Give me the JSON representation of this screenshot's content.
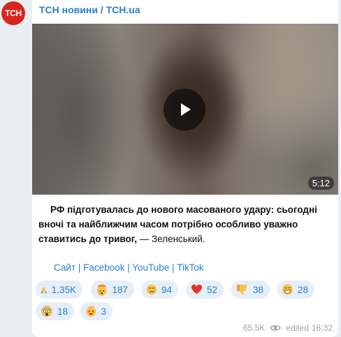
{
  "channel": {
    "avatar_text": "ТСН",
    "name": "ТСН новини / TCH.ua"
  },
  "video": {
    "duration": "5:12"
  },
  "post": {
    "text_bold": "РФ підготувалась до нового масованого удару: сьогодні вночі та найближчим часом потрібно особливо уважно ставитись до тривог,",
    "text_rest": " — Зеленський."
  },
  "links": [
    {
      "label": "Сайт"
    },
    {
      "label": "Facebook"
    },
    {
      "label": "YouTube"
    },
    {
      "label": "TikTok"
    }
  ],
  "reactions": [
    {
      "emoji": "pray-emoji",
      "count": "1.35K"
    },
    {
      "emoji": "exploding-head-emoji",
      "count": "187"
    },
    {
      "emoji": "crying-face-emoji",
      "count": "94"
    },
    {
      "emoji": "red-heart-emoji",
      "count": "52"
    },
    {
      "emoji": "thumbs-down-emoji",
      "count": "38"
    },
    {
      "emoji": "grinning-face-emoji",
      "count": "28"
    },
    {
      "emoji": "screaming-face-emoji",
      "count": "18"
    },
    {
      "emoji": "star-struck-emoji",
      "count": "3"
    }
  ],
  "meta": {
    "views": "65.5K",
    "edited_label": "edited",
    "time": "16:32"
  },
  "colors": {
    "accent": "#2a7ec9",
    "avatar_bg": "#d7261e",
    "reaction_bg": "#e6eff8"
  }
}
